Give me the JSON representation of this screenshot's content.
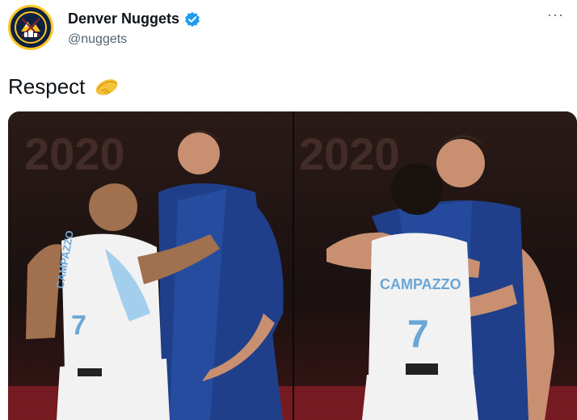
{
  "account": {
    "display_name": "Denver Nuggets",
    "handle": "@nuggets",
    "verified": true,
    "avatar_icon": "nuggets-logo-icon"
  },
  "menu": {
    "more_label": "···"
  },
  "tweet": {
    "text": "Respect",
    "emoji_icon": "handshake-icon"
  },
  "media": {
    "photos": [
      {
        "scoreboard": "2020",
        "jersey_name": "CAMPAZZO",
        "jersey_number": "7"
      },
      {
        "scoreboard": "2020",
        "jersey_name": "CAMPAZZO",
        "jersey_number": "7"
      }
    ]
  },
  "colors": {
    "accent": "#1d9bf0",
    "nuggets_navy": "#0e2240",
    "nuggets_gold": "#fec524",
    "slovenia_blue": "#1f3f8a"
  }
}
